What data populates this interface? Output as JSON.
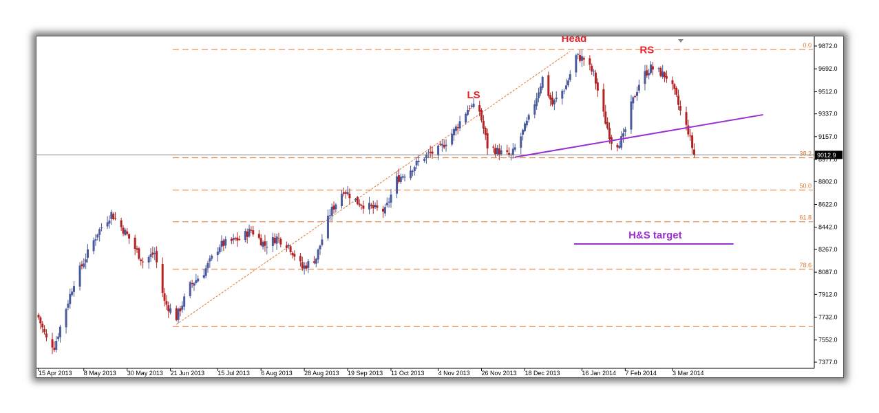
{
  "chart_data": {
    "type": "candlestick",
    "x_ticks": [
      "15 Apr 2013",
      "8 May 2013",
      "30 May 2013",
      "21 Jun 2013",
      "15 Jul 2013",
      "6 Aug 2013",
      "28 Aug 2013",
      "19 Sep 2013",
      "11 Oct 2013",
      "4 Nov 2013",
      "26 Nov 2013",
      "18 Dec 2013",
      "16 Jan 2014",
      "7 Feb 2014",
      "3 Mar 2014"
    ],
    "y_ticks": [
      "9872.0",
      "9692.0",
      "9512.0",
      "9337.0",
      "9157.0",
      "8977.0",
      "8802.0",
      "8622.0",
      "8442.0",
      "8267.0",
      "8087.0",
      "7912.0",
      "7732.0",
      "7552.0",
      "7377.0"
    ],
    "ylim": [
      7377,
      9872
    ],
    "current_price": "9012.9",
    "fibonacci_levels": [
      {
        "label": "0.0",
        "price": 9845
      },
      {
        "label": "38.2",
        "price": 8990
      },
      {
        "label": "50.0",
        "price": 8735
      },
      {
        "label": "61.8",
        "price": 8485
      },
      {
        "label": "78.6",
        "price": 8110
      },
      {
        "label": "",
        "price": 7658
      }
    ],
    "pattern_labels": [
      {
        "text": "LS",
        "date": "2013-11-22",
        "price": 9460
      },
      {
        "text": "Head",
        "date": "2014-01-12",
        "price": 9905
      },
      {
        "text": "RS",
        "date": "2014-02-18",
        "price": 9815
      }
    ],
    "neckline": {
      "from": [
        "2013-12-13",
        8995
      ],
      "to": [
        "2014-04-18",
        9330
      ]
    },
    "hs_target": {
      "label": "H&S target",
      "from": "2014-01-12",
      "to": "2014-04-03",
      "price": 8310
    },
    "rally_channel": {
      "lower": [
        [
          "2013-06-24",
          7675
        ],
        [
          "2014-01-10",
          9830
        ]
      ],
      "upper": [
        [
          "2013-06-24",
          7675
        ],
        [
          "2014-01-10",
          9830
        ]
      ]
    },
    "colors": {
      "up": "#4a5a9a",
      "down": "#b22222",
      "fib": "#e0742c",
      "neckline": "#9a2fd0",
      "pattern_text": "#e8202a",
      "price_line": "#808080"
    }
  }
}
